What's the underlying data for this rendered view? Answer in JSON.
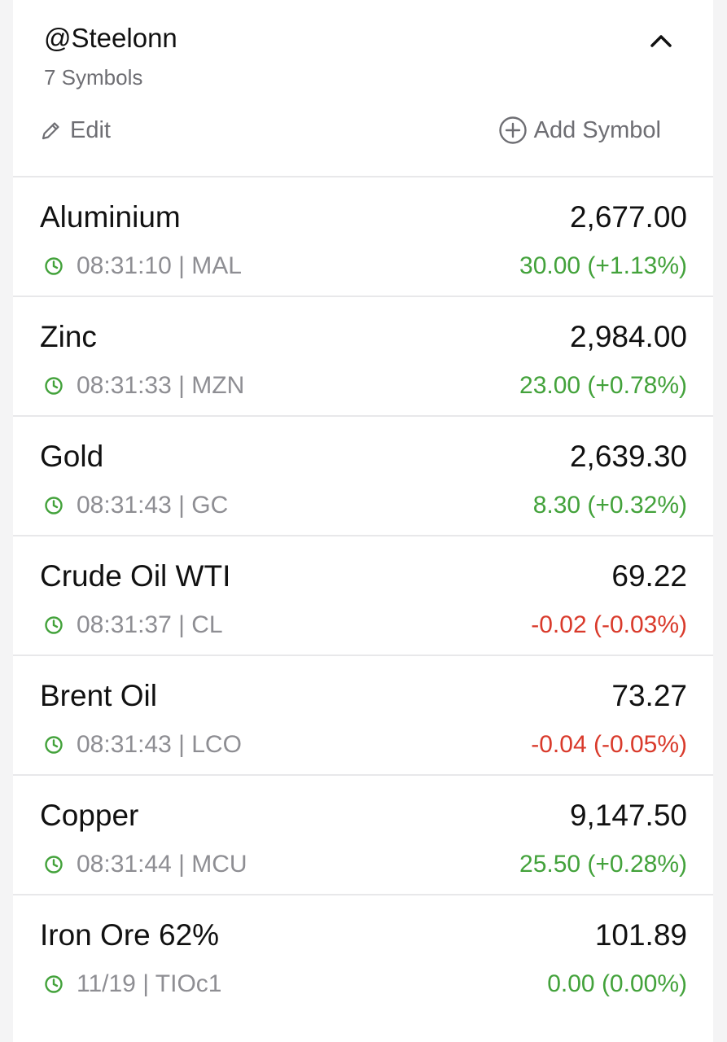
{
  "watchlist": {
    "owner": "@Steelonn",
    "symbol_count": "7 Symbols",
    "edit_label": "Edit",
    "add_symbol_label": "Add Symbol"
  },
  "colors": {
    "positive": "#43a23b",
    "negative": "#d93a2b",
    "clock_icon": "#43a23b"
  },
  "symbols": [
    {
      "name": "Aluminium",
      "price": "2,677.00",
      "time": "08:31:10",
      "ticker": "MAL",
      "change": "30.00 (+1.13%)",
      "direction": "up"
    },
    {
      "name": "Zinc",
      "price": "2,984.00",
      "time": "08:31:33",
      "ticker": "MZN",
      "change": "23.00 (+0.78%)",
      "direction": "up"
    },
    {
      "name": "Gold",
      "price": "2,639.30",
      "time": "08:31:43",
      "ticker": "GC",
      "change": "8.30 (+0.32%)",
      "direction": "up"
    },
    {
      "name": "Crude Oil WTI",
      "price": "69.22",
      "time": "08:31:37",
      "ticker": "CL",
      "change": "-0.02 (-0.03%)",
      "direction": "down"
    },
    {
      "name": "Brent Oil",
      "price": "73.27",
      "time": "08:31:43",
      "ticker": "LCO",
      "change": "-0.04 (-0.05%)",
      "direction": "down"
    },
    {
      "name": "Copper",
      "price": "9,147.50",
      "time": "08:31:44",
      "ticker": "MCU",
      "change": "25.50 (+0.28%)",
      "direction": "up"
    },
    {
      "name": "Iron Ore 62%",
      "price": "101.89",
      "time": "11/19",
      "ticker": "TIOc1",
      "change": "0.00 (0.00%)",
      "direction": "up"
    }
  ]
}
